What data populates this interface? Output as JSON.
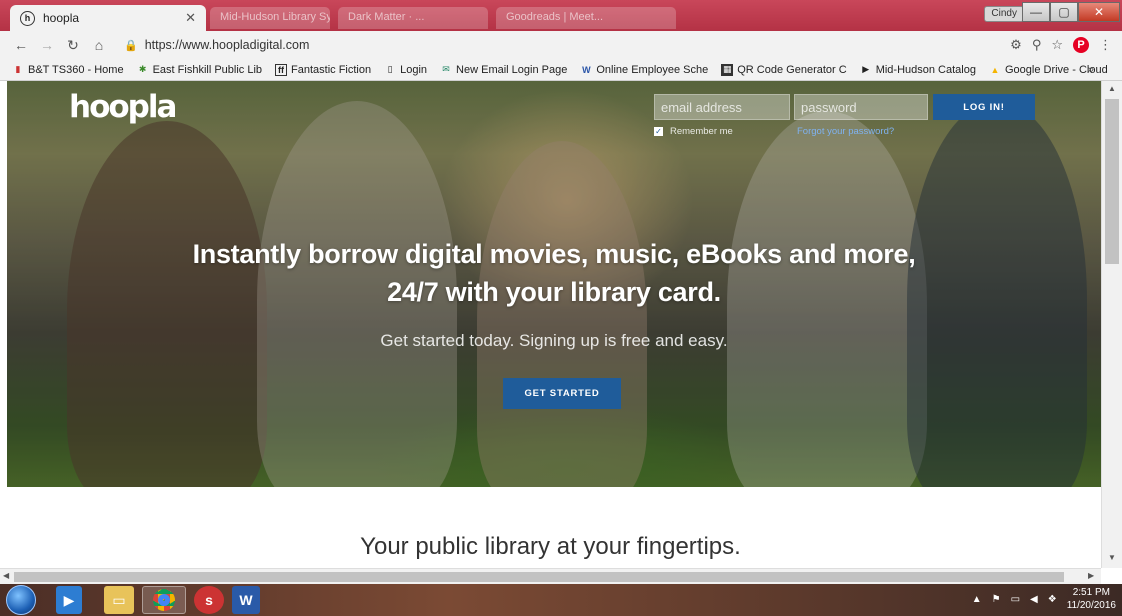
{
  "browser": {
    "active_tab_title": "hoopla",
    "active_tab_favicon": "h",
    "inactive_tabs": [
      "Mid-Hudson Library Sy...",
      "Dark Matter · ...",
      "Goodreads | Meet..."
    ],
    "user_badge": "Cindy",
    "url": "https://www.hoopladigital.com",
    "bookmarks": [
      {
        "label": "B&T TS360 - Home",
        "icon": "bt-icon"
      },
      {
        "label": "East Fishkill Public Lib",
        "icon": "palm-icon"
      },
      {
        "label": "Fantastic Fiction",
        "icon": "ff-icon"
      },
      {
        "label": "Login",
        "icon": "page-icon"
      },
      {
        "label": "New Email Login Page",
        "icon": "email-icon"
      },
      {
        "label": "Online Employee Sche",
        "icon": "w-icon"
      },
      {
        "label": "QR Code Generator C",
        "icon": "qr-icon"
      },
      {
        "label": "Mid-Hudson Catalog",
        "icon": "play-icon"
      },
      {
        "label": "Google Drive - Cloud",
        "icon": "drive-icon"
      }
    ],
    "bookmarks_more": "»"
  },
  "page": {
    "logo": "hoopla",
    "login": {
      "email_placeholder": "email address",
      "password_placeholder": "password",
      "button_label": "LOG IN!",
      "remember_label": "Remember me",
      "forgot_label": "Forgot your password?"
    },
    "hero": {
      "headline_line1": "Instantly borrow digital movies, music, eBooks and more,",
      "headline_line2": "24/7 with your library card.",
      "subheadline": "Get started today. Signing up is free and easy.",
      "cta_label": "GET STARTED"
    },
    "tagline": "Your public library at your fingertips."
  },
  "taskbar": {
    "time": "2:51 PM",
    "date": "11/20/2016"
  },
  "colors": {
    "brand_blue": "#1f5c9a",
    "chrome_tab_bar": "#c43a4d"
  }
}
